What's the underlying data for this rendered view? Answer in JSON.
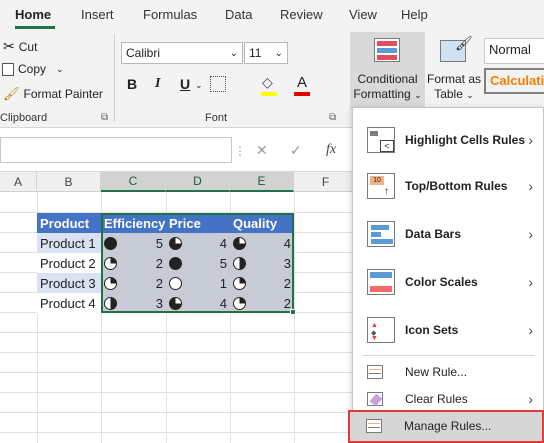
{
  "tabs": [
    "Home",
    "Insert",
    "Formulas",
    "Data",
    "Review",
    "View",
    "Help"
  ],
  "clipboard": {
    "cut": "Cut",
    "copy": "Copy",
    "format_painter": "Format Painter",
    "group_label": "Clipboard"
  },
  "font": {
    "family": "Calibri",
    "size": "11",
    "group_label": "Font",
    "bold": "B",
    "italic": "I",
    "underline": "U"
  },
  "styles": {
    "conditional_formatting": [
      "Conditional",
      "Formatting"
    ],
    "format_as_table": [
      "Format as",
      "Table"
    ],
    "normal": "Normal",
    "calculation": "Calculatio"
  },
  "formula_bar": {
    "cancel": "✕",
    "enter": "✓",
    "fx": "fx"
  },
  "columns": [
    "A",
    "B",
    "C",
    "D",
    "E",
    "F"
  ],
  "table": {
    "headers": [
      "Product",
      "Efficiency",
      "Price",
      "Quality"
    ],
    "rows": [
      {
        "product": "Product 1",
        "efficiency": "5",
        "price": "4",
        "quality": "4"
      },
      {
        "product": "Product 2",
        "efficiency": "2",
        "price": "5",
        "quality": "3"
      },
      {
        "product": "Product 3",
        "efficiency": "2",
        "price": "1",
        "quality": "2"
      },
      {
        "product": "Product 4",
        "efficiency": "3",
        "price": "4",
        "quality": "2"
      }
    ]
  },
  "menu": {
    "highlight_cells_rules": "Highlight Cells Rules",
    "top_bottom_rules": "Top/Bottom Rules",
    "data_bars": "Data Bars",
    "color_scales": "Color Scales",
    "icon_sets": "Icon Sets",
    "new_rule": "New Rule...",
    "clear_rules": "Clear Rules",
    "manage_rules": "Manage Rules..."
  },
  "colors": {
    "accent": "#217346",
    "table_header": "#4472c4",
    "highlight": "#e23b3b"
  }
}
